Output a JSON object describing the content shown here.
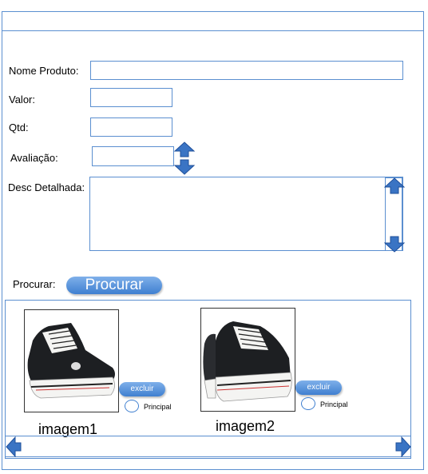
{
  "form": {
    "nome_produto_label": "Nome Produto:",
    "nome_produto_value": "",
    "valor_label": "Valor:",
    "valor_value": "",
    "qtd_label": "Qtd:",
    "qtd_value": "",
    "avaliacao_label": "Avaliação:",
    "avaliacao_value": "",
    "desc_label": "Desc Detalhada:",
    "desc_value": ""
  },
  "search": {
    "label": "Procurar:",
    "button_label": "Procurar"
  },
  "gallery": {
    "images": [
      {
        "caption": "imagem1",
        "delete_label": "excluir",
        "principal_label": "Principal",
        "image_icon": "sneaker-side-view-icon"
      },
      {
        "caption": "imagem2",
        "delete_label": "excluir",
        "principal_label": "Principal",
        "image_icon": "sneaker-angled-view-icon"
      }
    ]
  },
  "colors": {
    "border": "#5b8fd0",
    "button_gradient_top": "#7fb0ea",
    "button_gradient_bottom": "#3f7fd0",
    "arrow_fill": "#3a74c4"
  }
}
